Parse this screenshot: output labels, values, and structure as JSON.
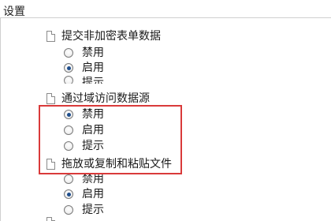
{
  "settings": {
    "title": "设置",
    "groups": [
      {
        "label": "提交非加密表单数据",
        "options": [
          {
            "label": "禁用",
            "checked": false
          },
          {
            "label": "启用",
            "checked": true
          },
          {
            "label": "提示",
            "checked": false
          }
        ]
      },
      {
        "label": "通过域访问数据源",
        "options": [
          {
            "label": "禁用",
            "checked": true
          },
          {
            "label": "启用",
            "checked": false
          },
          {
            "label": "提示",
            "checked": false
          }
        ]
      },
      {
        "label": "拖放或复制和粘贴文件",
        "options": [
          {
            "label": "禁用",
            "checked": false
          },
          {
            "label": "启用",
            "checked": true
          },
          {
            "label": "提示",
            "checked": false
          }
        ]
      }
    ]
  },
  "highlight": {
    "color": "#d93a3a"
  },
  "colors": {
    "radio_dot": "#1f4e8c",
    "panel_border": "#cfcfcf"
  }
}
